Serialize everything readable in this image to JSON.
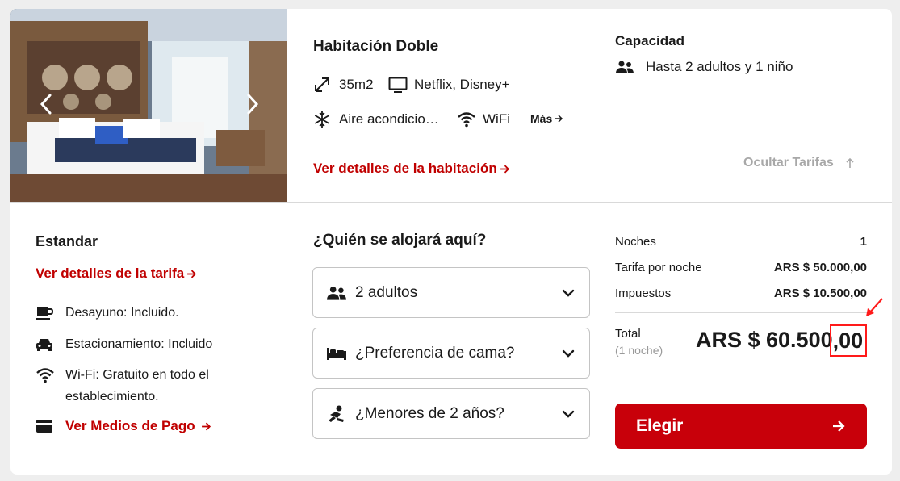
{
  "room": {
    "title": "Habitación Doble",
    "size": "35m2",
    "tv": "Netflix, Disney+",
    "ac": "Aire acondicionado",
    "wifi": "WiFi",
    "more": "Más",
    "details_link": "Ver detalles de la habitación"
  },
  "capacity": {
    "title": "Capacidad",
    "text": "Hasta 2 adultos y 1 niño"
  },
  "hide_rates": "Ocultar Tarifas",
  "rate": {
    "name": "Estandar",
    "details_link": "Ver detalles de la tarifa",
    "inclusions": [
      {
        "icon": "coffee-cup-icon",
        "text": "Desayuno: Incluido."
      },
      {
        "icon": "car-icon",
        "text": "Estacionamiento: Incluido"
      },
      {
        "icon": "wifi-icon",
        "text": "Wi-Fi: Gratuito en todo el establecimiento."
      }
    ],
    "payment_link": "Ver Medios de Pago"
  },
  "guests": {
    "title": "¿Quién se alojará aquí?",
    "adults": "2 adultos",
    "bed": "¿Preferencia de cama?",
    "infants": "¿Menores de 2 años?"
  },
  "summary": {
    "nights_label": "Noches",
    "nights_value": "1",
    "rate_label": "Tarifa por noche",
    "rate_value": "ARS $ 50.000,00",
    "tax_label": "Impuestos",
    "tax_value": "ARS $ 10.500,00",
    "total_label": "Total",
    "total_sub": "(1 noche)",
    "total_main": "ARS $ 60.500",
    "total_decimal": ",00",
    "choose_label": "Elegir"
  },
  "colors": {
    "accent": "#c00000",
    "button": "#c8000a",
    "annotation": "#ff1a1a",
    "muted": "#a8a8a8"
  }
}
